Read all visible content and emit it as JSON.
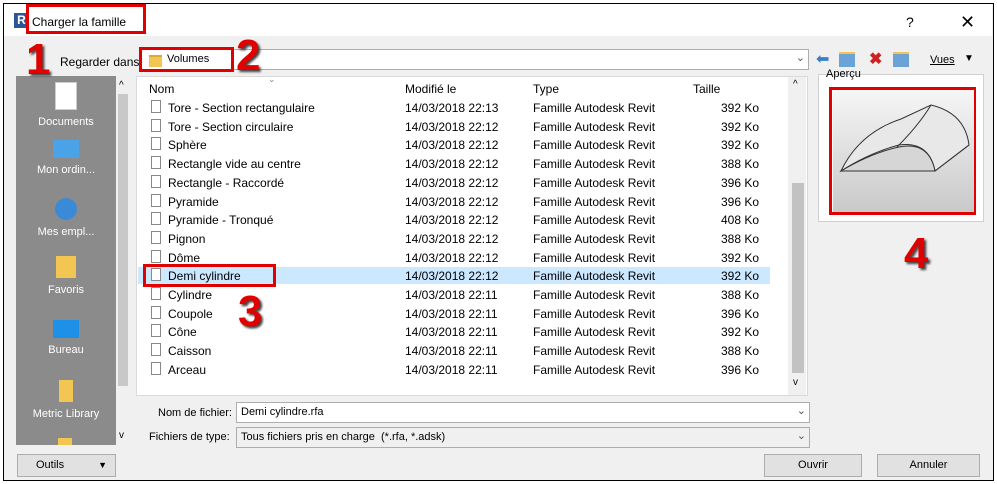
{
  "window": {
    "title": "Charger la famille",
    "help": "?",
    "close": "✕",
    "app_icon_letter": "R"
  },
  "lookin": {
    "label": "Regarder dans:",
    "value": "Volumes",
    "views_label": "Vues"
  },
  "places": [
    {
      "label": "Documents"
    },
    {
      "label": "Mon ordin..."
    },
    {
      "label": "Mes empl..."
    },
    {
      "label": "Favoris"
    },
    {
      "label": "Bureau"
    },
    {
      "label": "Metric Library"
    }
  ],
  "columns": {
    "name": "Nom",
    "modified": "Modifié le",
    "type": "Type",
    "size": "Taille"
  },
  "files": [
    {
      "name": "Tore - Section rectangulaire",
      "modified": "14/03/2018 22:13",
      "type": "Famille Autodesk Revit",
      "size": "392 Ko"
    },
    {
      "name": "Tore - Section circulaire",
      "modified": "14/03/2018 22:12",
      "type": "Famille Autodesk Revit",
      "size": "392 Ko"
    },
    {
      "name": "Sphère",
      "modified": "14/03/2018 22:12",
      "type": "Famille Autodesk Revit",
      "size": "392 Ko"
    },
    {
      "name": "Rectangle vide au centre",
      "modified": "14/03/2018 22:12",
      "type": "Famille Autodesk Revit",
      "size": "388 Ko"
    },
    {
      "name": "Rectangle - Raccordé",
      "modified": "14/03/2018 22:12",
      "type": "Famille Autodesk Revit",
      "size": "396 Ko"
    },
    {
      "name": "Pyramide",
      "modified": "14/03/2018 22:12",
      "type": "Famille Autodesk Revit",
      "size": "396 Ko"
    },
    {
      "name": "Pyramide - Tronqué",
      "modified": "14/03/2018 22:12",
      "type": "Famille Autodesk Revit",
      "size": "408 Ko"
    },
    {
      "name": "Pignon",
      "modified": "14/03/2018 22:12",
      "type": "Famille Autodesk Revit",
      "size": "388 Ko"
    },
    {
      "name": "Dôme",
      "modified": "14/03/2018 22:12",
      "type": "Famille Autodesk Revit",
      "size": "392 Ko"
    },
    {
      "name": "Demi cylindre",
      "modified": "14/03/2018 22:12",
      "type": "Famille Autodesk Revit",
      "size": "392 Ko"
    },
    {
      "name": "Cylindre",
      "modified": "14/03/2018 22:11",
      "type": "Famille Autodesk Revit",
      "size": "388 Ko"
    },
    {
      "name": "Coupole",
      "modified": "14/03/2018 22:11",
      "type": "Famille Autodesk Revit",
      "size": "396 Ko"
    },
    {
      "name": "Cône",
      "modified": "14/03/2018 22:11",
      "type": "Famille Autodesk Revit",
      "size": "392 Ko"
    },
    {
      "name": "Caisson",
      "modified": "14/03/2018 22:11",
      "type": "Famille Autodesk Revit",
      "size": "388 Ko"
    },
    {
      "name": "Arceau",
      "modified": "14/03/2018 22:11",
      "type": "Famille Autodesk Revit",
      "size": "396 Ko"
    }
  ],
  "selected_file": "Demi cylindre",
  "preview": {
    "label": "Aperçu"
  },
  "filename": {
    "label": "Nom de fichier:",
    "value": "Demi cylindre.rfa"
  },
  "filetype": {
    "label": "Fichiers de type:",
    "value": "Tous fichiers pris en charge  (*.rfa, *.adsk)"
  },
  "buttons": {
    "tools": "Outils",
    "open": "Ouvrir",
    "cancel": "Annuler"
  },
  "annotations": [
    "1",
    "2",
    "3",
    "4"
  ],
  "colors": {
    "annotation": "#e00000",
    "selection": "#cce8ff",
    "places_bg": "#8b8b8b"
  }
}
